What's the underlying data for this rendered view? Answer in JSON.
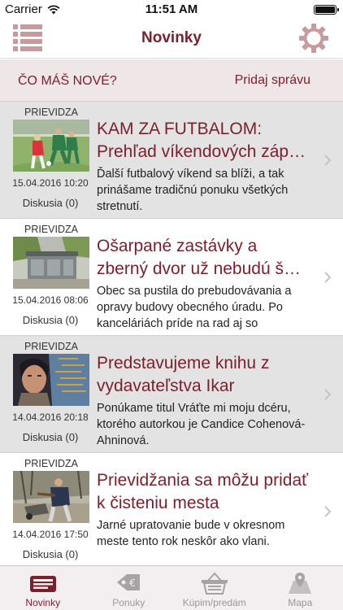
{
  "status_bar": {
    "carrier": "Carrier",
    "time": "11:51 AM"
  },
  "nav": {
    "title": "Novinky",
    "menu_icon": "list-icon",
    "settings_icon": "gear-icon"
  },
  "compose": {
    "prompt": "ČO MÁŠ NOVÉ?",
    "action": "Pridaj správu"
  },
  "articles": [
    {
      "source": "PRIEVIDZA",
      "title_line1": "KAM ZA FUTBALOM:",
      "title_line2": "Prehľad víkendových záp…",
      "excerpt": "Ďalší futbalový víkend sa blíži, a tak prinášame tradičnú ponuku všetkých stretnutí.",
      "date": "15.04.2016 10:20",
      "discussion": "Diskusia (0)"
    },
    {
      "source": "PRIEVIDZA",
      "title_line1": "Ošarpané zastávky a",
      "title_line2": "zberný dvor už nebudú š…",
      "excerpt": "Obec sa pustila do prebudovávania a opravy budovy obecného úradu. Po kanceláriách príde na rad aj so",
      "date": "15.04.2016 08:06",
      "discussion": "Diskusia (0)"
    },
    {
      "source": "PRIEVIDZA",
      "title_line1": "Predstavujeme knihu z",
      "title_line2": "vydavateľstva Ikar",
      "excerpt": "Ponúkame titul Vráťte mi moju dcéru, ktorého autorkou je Candice Cohenová-Ahninová.",
      "date": "14.04.2016 20:18",
      "discussion": "Diskusia (0)"
    },
    {
      "source": "PRIEVIDZA",
      "title_line1": "Prievidžania sa môžu pridať",
      "title_line2": "k čisteniu mesta",
      "excerpt": "Jarné upratovanie bude v okresnom meste tento rok neskôr ako vlani.",
      "date": "14.04.2016 17:50",
      "discussion": "Diskusia (0)"
    }
  ],
  "tabs": [
    {
      "label": "Novinky",
      "icon": "newspaper-icon",
      "active": true
    },
    {
      "label": "Ponuky",
      "icon": "price-tag-icon",
      "active": false
    },
    {
      "label": "Kúpim/predám",
      "icon": "shopping-basket-icon",
      "active": false
    },
    {
      "label": "Mapa",
      "icon": "map-pin-icon",
      "active": false
    }
  ],
  "colors": {
    "accent": "#7a1f2b",
    "compose_bg": "#efe6e8",
    "row_alt_bg": "#e3e3e3",
    "tab_inactive": "#999999"
  }
}
